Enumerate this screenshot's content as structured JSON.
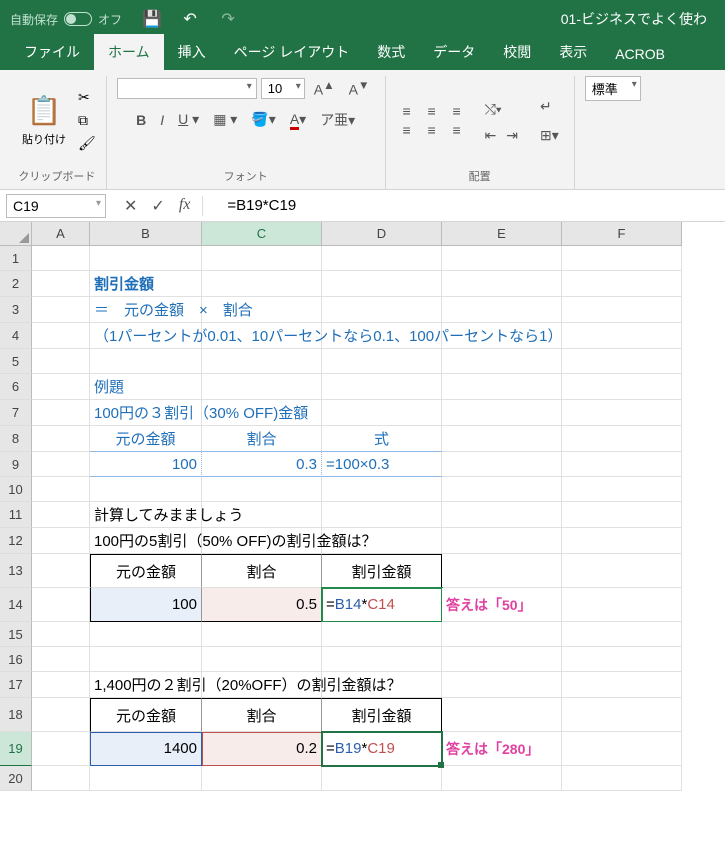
{
  "title": "01-ビジネスでよく使わ",
  "autosave": {
    "label": "自動保存",
    "state": "オフ"
  },
  "tabs": [
    "ファイル",
    "ホーム",
    "挿入",
    "ページ レイアウト",
    "数式",
    "データ",
    "校閲",
    "表示",
    "ACROB"
  ],
  "ribbon": {
    "clipboard": {
      "paste": "貼り付け",
      "group": "クリップボード"
    },
    "font": {
      "size": "10",
      "group": "フォント"
    },
    "alignment": {
      "group": "配置"
    },
    "number": {
      "format": "標準"
    }
  },
  "namebox": "C19",
  "formula": "=B19*C19",
  "cols": [
    "A",
    "B",
    "C",
    "D",
    "E",
    "F"
  ],
  "rows": [
    "1",
    "2",
    "3",
    "4",
    "5",
    "6",
    "7",
    "8",
    "9",
    "10",
    "11",
    "12",
    "13",
    "14",
    "15",
    "16",
    "17",
    "18",
    "19",
    "20"
  ],
  "sheet": {
    "b2": "割引金額",
    "b3": "＝　元の金額　×　割合",
    "b4": "（1パーセントが0.01、10パーセントなら0.1、100パーセントなら1）",
    "b6": "例題",
    "b7": "100円の３割引（30% OFF)金額",
    "b8": "元の金額",
    "c8": "割合",
    "d8": "式",
    "b9": "100",
    "c9": "0.3",
    "d9": "=100×0.3",
    "b11": "計算してみまましょう",
    "b12": "100円の5割引（50% OFF)の割引金額は？",
    "b13": "元の金額",
    "c13": "割合",
    "d13": "割引金額",
    "b14": "100",
    "c14": "0.5",
    "d14_prefix": "=",
    "d14_b": "B14",
    "d14_star": "*",
    "d14_c": "C14",
    "e14": "答えは「50」",
    "b17": "1,400円の２割引（20%OFF）の割引金額は？",
    "b18": "元の金額",
    "c18": "割合",
    "d18": "割引金額",
    "b19": "1400",
    "c19": "0.2",
    "d19_prefix": "=",
    "d19_b": "B19",
    "d19_star": "*",
    "d19_c": "C19",
    "e19": "答えは「280」"
  }
}
